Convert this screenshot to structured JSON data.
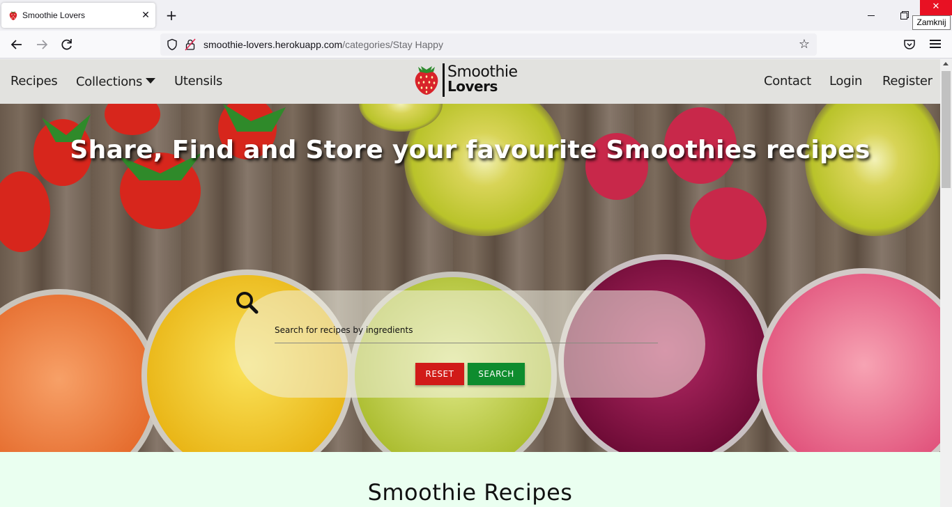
{
  "browser": {
    "tab_title": "Smoothie Lovers",
    "tab_close_symbol": "✕",
    "new_tab_symbol": "+",
    "close_symbol": "✕",
    "tooltip": "Zamknij",
    "url_domain": "smoothie-lovers.herokuapp.com",
    "url_path": "/categories/Stay Happy",
    "icons": [
      "back-icon",
      "forward-icon",
      "reload-icon",
      "shield-icon",
      "lock-icon",
      "star-icon",
      "pocket-icon",
      "menu-icon"
    ]
  },
  "header": {
    "nav_left": [
      "Recipes",
      "Collections",
      "Utensils"
    ],
    "nav_right": [
      "Contact",
      "Login",
      "Register"
    ],
    "logo_line1": "Smoothie",
    "logo_line2": "Lovers"
  },
  "hero": {
    "title": "Share, Find and Store your favourite Smoothies recipes"
  },
  "search": {
    "placeholder": "Search for recipes by ingredients",
    "reset_label": "RESET",
    "search_label": "SEARCH"
  },
  "section": {
    "title": "Smoothie Recipes"
  },
  "colors": {
    "header_bg": "#e2e2df",
    "reset": "#d11b18",
    "search": "#0e8c2e",
    "page_bg": "#eafff0",
    "close_red": "#e81123"
  }
}
